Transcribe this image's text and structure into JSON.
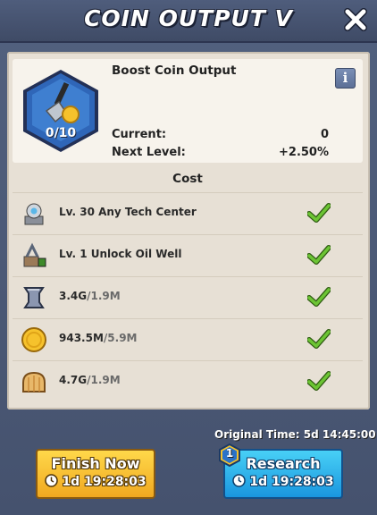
{
  "header": {
    "title": "COIN OUTPUT V"
  },
  "boost": {
    "title": "Boost Coin Output",
    "level": "0/10",
    "current_label": "Current:",
    "current_value": "0",
    "next_label": "Next Level:",
    "next_value": "+2.50%",
    "info_label": "i"
  },
  "cost": {
    "heading": "Cost",
    "rows": [
      {
        "icon": "tech-center-icon",
        "text": "Lv. 30 Any Tech Center",
        "have": "",
        "need": "",
        "met": true
      },
      {
        "icon": "oil-well-icon",
        "text": "Lv. 1 Unlock Oil Well",
        "have": "",
        "need": "",
        "met": true
      },
      {
        "icon": "iron-icon",
        "text": "",
        "have": "3.4G",
        "need": "/1.9M",
        "met": true
      },
      {
        "icon": "coin-icon",
        "text": "",
        "have": "943.5M",
        "need": "/5.9M",
        "met": true
      },
      {
        "icon": "bread-icon",
        "text": "",
        "have": "4.7G",
        "need": "/1.9M",
        "met": true
      }
    ]
  },
  "footer": {
    "original_time": "Original Time: 5d 14:45:00",
    "finish_label": "Finish Now",
    "finish_time": "1d 19:28:03",
    "research_label": "Research",
    "research_time": "1d 19:28:03",
    "research_badge": "1"
  },
  "colors": {
    "accent_blue": "#1a96df",
    "accent_yellow": "#f0a820",
    "check_green": "#6cc434"
  }
}
